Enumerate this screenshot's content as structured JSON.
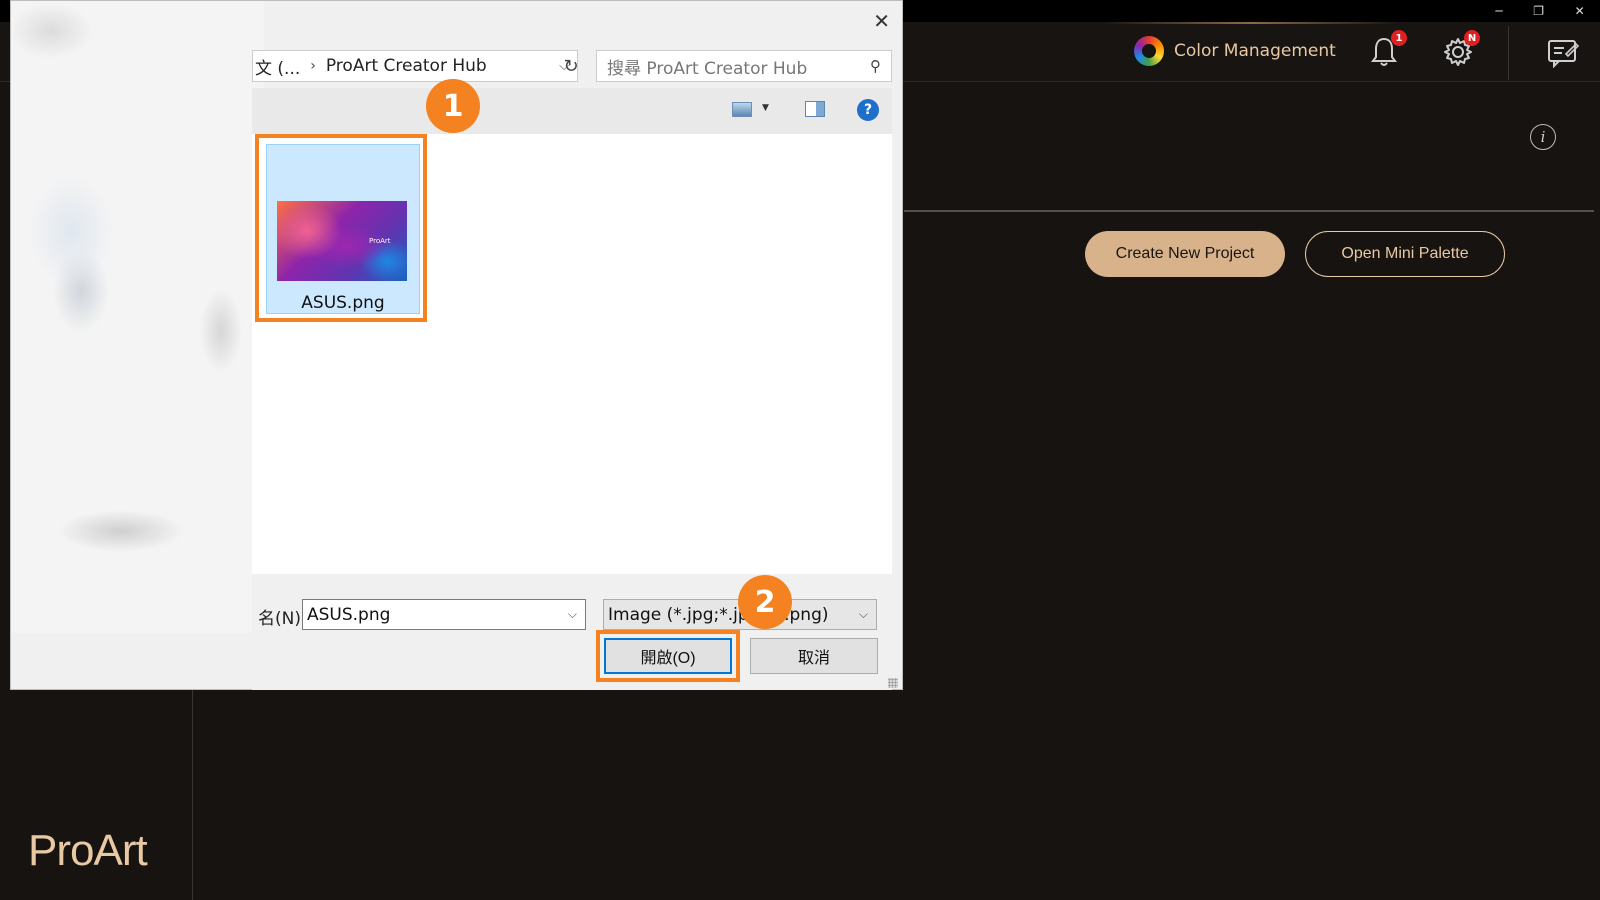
{
  "header": {
    "color_management_label": "Color Management",
    "notification_badge": "1",
    "settings_badge": "N"
  },
  "main": {
    "create_project_label": "Create New Project",
    "open_palette_label": "Open Mini Palette",
    "info_glyph": "i"
  },
  "brand": {
    "logo_text": "ProArt"
  },
  "dialog": {
    "breadcrumb_prefix": "文 (...",
    "breadcrumb_current": "ProArt Creator Hub",
    "search_placeholder": "搜尋 ProArt Creator Hub",
    "file": {
      "name": "ASUS.png",
      "thumb_text": "ProArt"
    },
    "filename_label": "名(N):",
    "filename_value": "ASUS.png",
    "filetype_value": "Image (*.jpg;*.jpeg;*.png)",
    "open_label": "開啟(O)",
    "cancel_label": "取消",
    "help_glyph": "?"
  },
  "annotations": {
    "step1": "1",
    "step2": "2"
  },
  "colors": {
    "accent_orange": "#f48220",
    "brand_gold": "#e8c9a3",
    "button_gold": "#d8b28a"
  }
}
